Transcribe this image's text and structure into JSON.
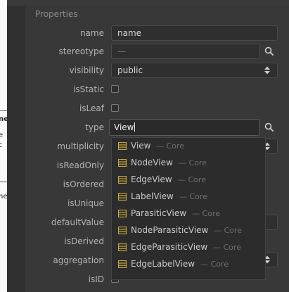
{
  "panel": {
    "section_title": "Properties"
  },
  "rows": {
    "name": {
      "label": "name",
      "value": "name"
    },
    "stereotype": {
      "label": "stereotype",
      "value": "—"
    },
    "visibility": {
      "label": "visibility",
      "value": "public"
    },
    "isStatic": {
      "label": "isStatic"
    },
    "isLeaf": {
      "label": "isLeaf"
    },
    "type": {
      "label": "type",
      "value": "View"
    },
    "multiplicity": {
      "label": "multiplicity"
    },
    "isReadOnly": {
      "label": "isReadOnly"
    },
    "isOrdered": {
      "label": "isOrdered"
    },
    "isUnique": {
      "label": "isUnique"
    },
    "defaultValue": {
      "label": "defaultValue"
    },
    "isDerived": {
      "label": "isDerived"
    },
    "aggregation": {
      "label": "aggregation"
    },
    "isID": {
      "label": "isID"
    }
  },
  "type_suggestions": [
    {
      "name": "View",
      "meta": "— Core"
    },
    {
      "name": "NodeView",
      "meta": "— Core"
    },
    {
      "name": "EdgeView",
      "meta": "— Core"
    },
    {
      "name": "LabelView",
      "meta": "— Core"
    },
    {
      "name": "ParasiticView",
      "meta": "— Core"
    },
    {
      "name": "NodeParasiticView",
      "meta": "— Core"
    },
    {
      "name": "EdgeParasiticView",
      "meta": "— Core"
    },
    {
      "name": "EdgeLabelView",
      "meta": "— Core"
    }
  ],
  "canvas_fragments": [
    "ne",
    "e",
    "c",
    "he"
  ],
  "colors": {
    "panel_bg": "#383839",
    "field_bg": "#2f2f30",
    "class_icon": "#c8a93a"
  },
  "icons": {
    "stereotype_search": "search-icon",
    "type_search": "search-icon",
    "select_arrows": "select-arrows-icon",
    "suggestion": "class-icon"
  }
}
